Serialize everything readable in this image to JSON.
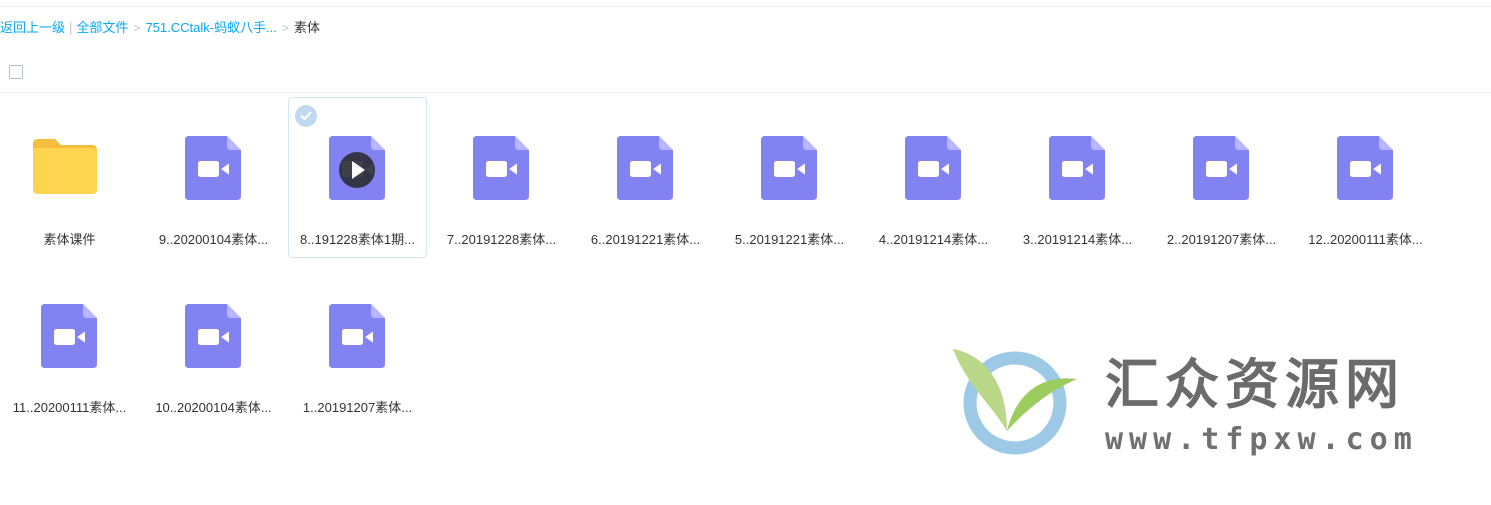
{
  "breadcrumb": {
    "back": "返回上一级",
    "all_files": "全部文件",
    "parent": "751.CCtalk-蚂蚁八手...",
    "current": "素体",
    "separator": ">",
    "divider": "|"
  },
  "colors": {
    "link": "#06a7ff",
    "video_icon": "#8282f3",
    "folder": "#ffd54f",
    "selected_border": "#d4e7f5"
  },
  "files": [
    {
      "name": "素体课件",
      "type": "folder",
      "icon": "folder-icon"
    },
    {
      "name": "9..20200104素体...",
      "type": "video",
      "icon": "video-file-icon"
    },
    {
      "name": "8..191228素体1期...",
      "type": "video",
      "icon": "video-file-icon",
      "selected": true,
      "play": true
    },
    {
      "name": "7..20191228素体...",
      "type": "video",
      "icon": "video-file-icon"
    },
    {
      "name": "6..20191221素体...",
      "type": "video",
      "icon": "video-file-icon"
    },
    {
      "name": "5..20191221素体...",
      "type": "video",
      "icon": "video-file-icon"
    },
    {
      "name": "4..20191214素体...",
      "type": "video",
      "icon": "video-file-icon"
    },
    {
      "name": "3..20191214素体...",
      "type": "video",
      "icon": "video-file-icon"
    },
    {
      "name": "2..20191207素体...",
      "type": "video",
      "icon": "video-file-icon"
    },
    {
      "name": "12..20200111素体...",
      "type": "video",
      "icon": "video-file-icon"
    },
    {
      "name": "11..20200111素体...",
      "type": "video",
      "icon": "video-file-icon"
    },
    {
      "name": "10..20200104素体...",
      "type": "video",
      "icon": "video-file-icon"
    },
    {
      "name": "1..20191207素体...",
      "type": "video",
      "icon": "video-file-icon"
    }
  ],
  "watermark": {
    "text": "汇众资源网",
    "url": "www.tfpxw.com"
  }
}
